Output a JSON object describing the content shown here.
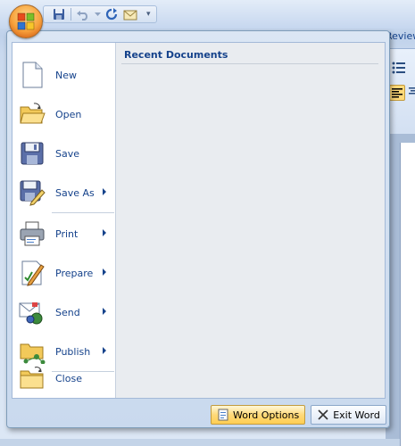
{
  "background": {
    "ribbon_tab": "Review"
  },
  "menu": {
    "items": [
      {
        "label": "New",
        "icon": "new-document-icon",
        "submenu": false
      },
      {
        "label": "Open",
        "icon": "open-folder-icon",
        "submenu": false
      },
      {
        "label": "Save",
        "icon": "save-disk-icon",
        "submenu": false
      },
      {
        "label": "Save As",
        "icon": "save-as-icon",
        "submenu": true
      },
      {
        "label": "Print",
        "icon": "printer-icon",
        "submenu": true
      },
      {
        "label": "Prepare",
        "icon": "prepare-icon",
        "submenu": true
      },
      {
        "label": "Send",
        "icon": "send-icon",
        "submenu": true
      },
      {
        "label": "Publish",
        "icon": "publish-icon",
        "submenu": true
      },
      {
        "label": "Close",
        "icon": "close-folder-icon",
        "submenu": false
      }
    ],
    "recent_title": "Recent Documents"
  },
  "footer": {
    "options_label": "Word Options",
    "exit_label": "Exit Word"
  },
  "colors": {
    "accent": "#15428b",
    "highlight": "#ffd979"
  }
}
